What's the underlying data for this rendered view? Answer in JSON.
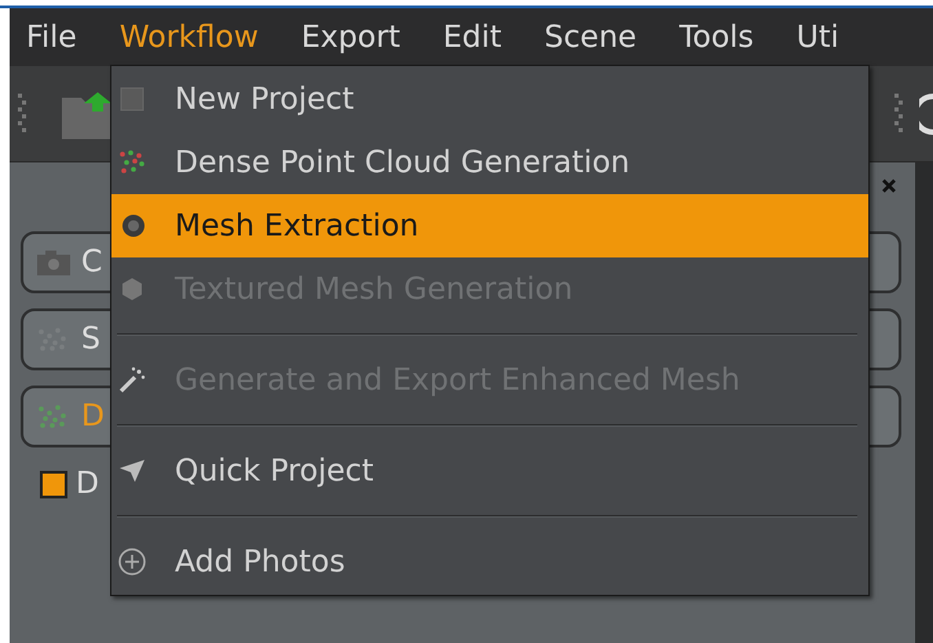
{
  "menu_bar": [
    {
      "label": "File",
      "selected": false
    },
    {
      "label": "Workflow",
      "selected": true
    },
    {
      "label": "Export",
      "selected": false
    },
    {
      "label": "Edit",
      "selected": false
    },
    {
      "label": "Scene",
      "selected": false
    },
    {
      "label": "Tools",
      "selected": false
    },
    {
      "label": "Uti",
      "selected": false
    }
  ],
  "panel": {
    "buttons": [
      {
        "label": "C",
        "selected": false
      },
      {
        "label": "S",
        "selected": false
      },
      {
        "label": "D",
        "selected": true
      }
    ],
    "checkbox": {
      "label": "D",
      "checked": true
    }
  },
  "menu": [
    {
      "kind": "item",
      "label": "New Project",
      "selected": false,
      "disabled": false
    },
    {
      "kind": "item",
      "label": "Dense Point Cloud Generation",
      "selected": false,
      "disabled": false
    },
    {
      "kind": "item",
      "label": "Mesh Extraction",
      "selected": true,
      "disabled": false
    },
    {
      "kind": "item",
      "label": "Textured Mesh Generation",
      "selected": false,
      "disabled": true
    },
    {
      "kind": "separator"
    },
    {
      "kind": "item",
      "label": "Generate and Export Enhanced Mesh",
      "selected": false,
      "disabled": true
    },
    {
      "kind": "separator"
    },
    {
      "kind": "item",
      "label": "Quick Project",
      "selected": false,
      "disabled": false
    },
    {
      "kind": "separator"
    },
    {
      "kind": "item",
      "label": "Add Photos",
      "selected": false,
      "disabled": false
    }
  ]
}
